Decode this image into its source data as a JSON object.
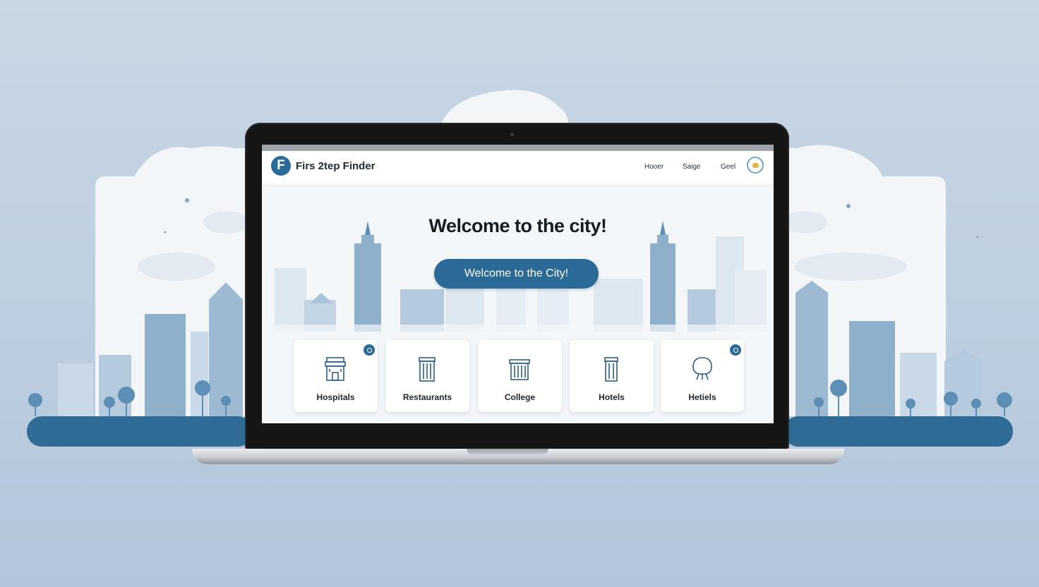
{
  "header": {
    "logo_letter": "F",
    "brand": "Firs 2tep Finder",
    "nav_links": [
      "Hooer",
      "Saige",
      "Geel"
    ]
  },
  "hero": {
    "title": "Welcome to the city!",
    "button_label": "Welcome to the City!"
  },
  "cards": [
    {
      "label": "Hospitals",
      "icon": "hospital-icon",
      "badge": true
    },
    {
      "label": "Restaurants",
      "icon": "restaurant-icon",
      "badge": false
    },
    {
      "label": "College",
      "icon": "college-icon",
      "badge": false
    },
    {
      "label": "Hotels",
      "icon": "hotel-icon",
      "badge": false
    },
    {
      "label": "Hetiels",
      "icon": "hotel-bell-icon",
      "badge": true
    }
  ],
  "colors": {
    "accent": "#2b6a96",
    "skyline": "#8fb0cb",
    "ground": "#2f6b95",
    "background": "#c5d4e2"
  }
}
